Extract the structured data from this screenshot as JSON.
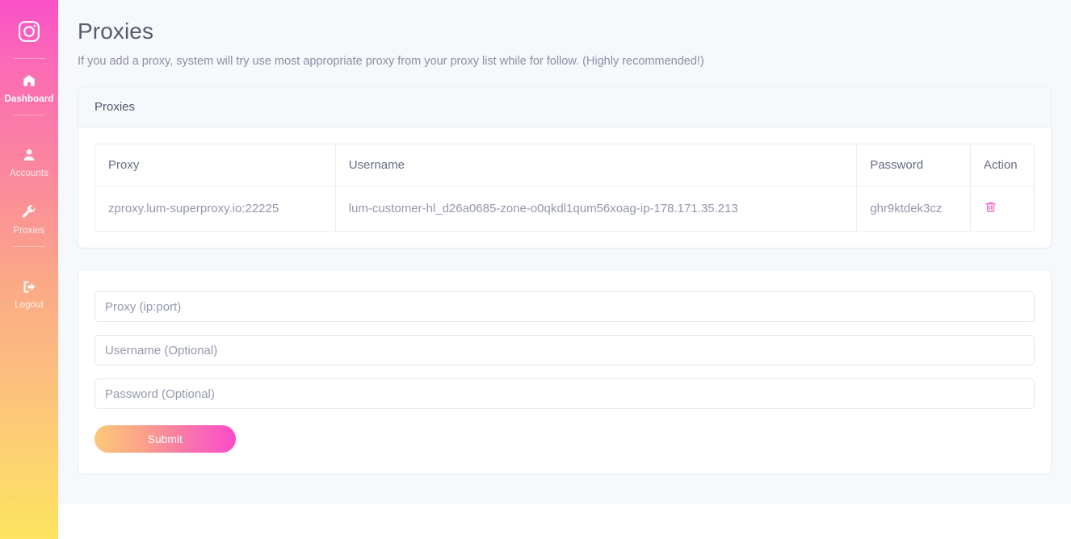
{
  "sidebar": {
    "logo_icon": "instagram-logo-icon",
    "items": [
      {
        "label": "Dashboard",
        "icon": "home-icon",
        "active": true
      },
      {
        "label": "Accounts",
        "icon": "user-icon",
        "active": false
      },
      {
        "label": "Proxies",
        "icon": "wrench-icon",
        "active": false
      },
      {
        "label": "Logout",
        "icon": "sign-out-icon",
        "active": false
      }
    ]
  },
  "page": {
    "title": "Proxies",
    "subtitle": "If you add a proxy, system will try use most appropriate proxy from your proxy list while for follow. (Highly recommended!)"
  },
  "proxies_card": {
    "header": "Proxies",
    "table": {
      "columns": [
        "Proxy",
        "Username",
        "Password",
        "Action"
      ],
      "rows": [
        {
          "proxy": "zproxy.lum-superproxy.io:22225",
          "username": "lum-customer-hl_d26a0685-zone-o0qkdl1qum56xoag-ip-178.171.35.213",
          "password": "ghr9ktdek3cz",
          "action_icon": "trash-icon"
        }
      ]
    }
  },
  "add_proxy_form": {
    "proxy_placeholder": "Proxy (ip:port)",
    "proxy_value": "",
    "username_placeholder": "Username (Optional)",
    "username_value": "",
    "password_placeholder": "Password (Optional)",
    "password_value": "",
    "submit_label": "Submit"
  },
  "colors": {
    "sidebar_gradient_start": "#fa50c8",
    "sidebar_gradient_end": "#fde35f",
    "accent_pink": "#fa4bc9",
    "accent_orange": "#fcc878",
    "trash_icon": "#fb5fc0",
    "page_bg": "#f7f8fc",
    "card_border": "#e9edf3",
    "title_text": "#565b6b",
    "muted_text": "#9297ab"
  }
}
